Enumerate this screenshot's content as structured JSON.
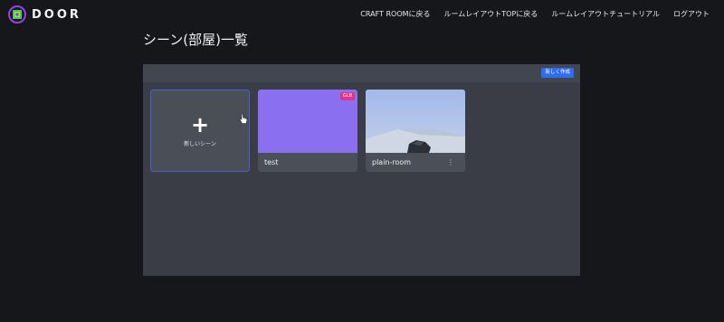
{
  "header": {
    "logo_text": "DOOR",
    "nav": [
      "CRAFT ROOMに戻る",
      "ルームレイアウトTOPに戻る",
      "ルームレイアウトチュートリアル",
      "ログアウト"
    ]
  },
  "page": {
    "title": "シーン(部屋)一覧"
  },
  "panel": {
    "new_button_label": "新しく作成",
    "new_scene_card": {
      "icon": "plus-icon",
      "plus_glyph": "+",
      "label": "新しいシーン"
    },
    "scenes": [
      {
        "name": "test",
        "badge": "GLB",
        "thumbnail_color": "#8a6ff0"
      },
      {
        "name": "plain-room",
        "menu_glyph": "⋮",
        "thumbnail": "3d-scene-thumbnail"
      }
    ]
  },
  "colors": {
    "background": "#16171b",
    "panel": "#3a3d45",
    "accent_blue": "#2f6cf0",
    "badge_pink": "#e0338a"
  }
}
